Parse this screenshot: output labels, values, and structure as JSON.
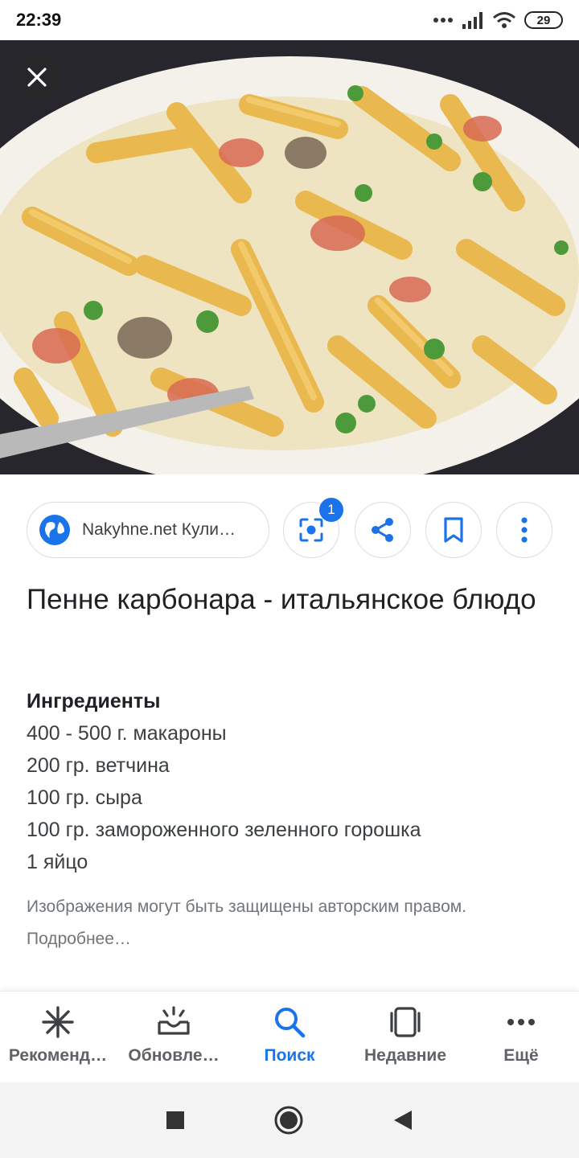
{
  "status_bar": {
    "time": "22:39",
    "battery": "29"
  },
  "actions": {
    "source_label": "Nakyhne.net Кули…",
    "lens_badge": "1"
  },
  "content": {
    "title": "Пенне карбонара - итальянское блюдо",
    "ingredients_heading": "Ингредиенты",
    "ingredients": [
      "400 - 500 г. макароны",
      "200 гр. ветчина",
      "100 гр. сыра",
      "100 гр. замороженного зеленного горошка",
      "1 яйцо"
    ],
    "copyright_note": "Изображения могут быть защищены авторским правом.",
    "more_link": "Подробнее…"
  },
  "bottom_nav": {
    "items": [
      {
        "label": "Рекоменд…",
        "icon": "asterisk-icon"
      },
      {
        "label": "Обновле…",
        "icon": "updates-tray-icon"
      },
      {
        "label": "Поиск",
        "icon": "search-icon"
      },
      {
        "label": "Недавние",
        "icon": "recent-cards-icon"
      },
      {
        "label": "Ещё",
        "icon": "more-dots-icon"
      }
    ]
  },
  "colors": {
    "accent": "#1a73e8",
    "text": "#202124",
    "muted": "#70757a"
  }
}
